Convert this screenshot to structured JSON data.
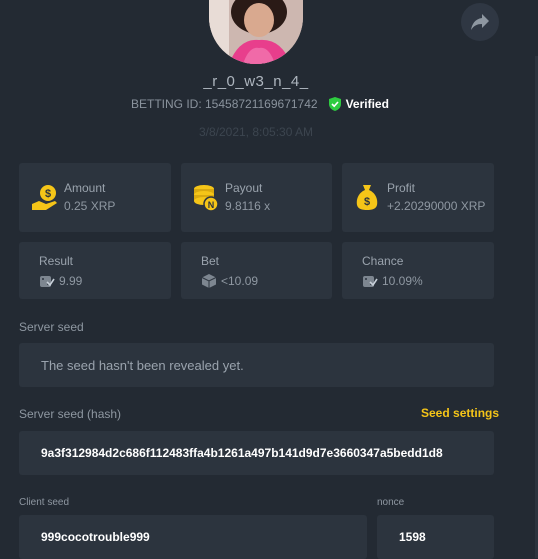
{
  "profile": {
    "username": "_r_0_w3_n_4_",
    "betting_id_label": "BETTING ID: 15458721169671742",
    "verified_label": "Verified",
    "timestamp": "3/8/2021, 8:05:30 AM"
  },
  "stats": {
    "amount": {
      "label": "Amount",
      "value": "0.25 XRP"
    },
    "payout": {
      "label": "Payout",
      "value": "9.8116 x"
    },
    "profit": {
      "label": "Profit",
      "value": "+2.20290000 XRP"
    },
    "result": {
      "label": "Result",
      "value": "9.99"
    },
    "bet": {
      "label": "Bet",
      "value": "<10.09"
    },
    "chance": {
      "label": "Chance",
      "value": "10.09%"
    }
  },
  "server_seed": {
    "label": "Server seed",
    "value": "The seed hasn't been revealed yet."
  },
  "server_seed_hash": {
    "label": "Server seed (hash)",
    "settings_link": "Seed settings",
    "value": "9a3f312984d2c686f112483ffa4b1261a497b141d9d7e3660347a5bedd1d8"
  },
  "client_seed": {
    "label": "Client seed",
    "value": "999cocotrouble999"
  },
  "nonce": {
    "label": "nonce",
    "value": "1598"
  },
  "icons": {
    "share": "share-icon",
    "verified": "shield-check-icon",
    "amount": "coin-hand-icon",
    "payout": "coin-stack-icon",
    "profit": "money-bag-icon",
    "result": "dice-check-icon",
    "bet": "dice-icon",
    "chance": "dice-check-icon"
  },
  "colors": {
    "background": "#232a33",
    "card": "#2c343e",
    "accent_gold": "#f5c518",
    "verified_green": "#2ecc40"
  }
}
